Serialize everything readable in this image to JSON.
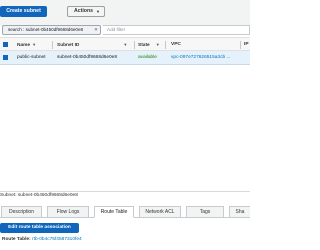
{
  "toolbar": {
    "create_label": "Create subnet",
    "actions_label": "Actions"
  },
  "filter": {
    "search_text": "search : subnet-0b450df9668d6e0e8",
    "add_filter_placeholder": "Add filter"
  },
  "table": {
    "headers": {
      "name": "Name",
      "subnet_id": "Subnet ID",
      "state": "State",
      "vpc": "VPC",
      "ipv4": "IP"
    },
    "rows": [
      {
        "name": "public-subnet",
        "subnet_id": "subnet-0b450df9668d6e0e8",
        "state": "available",
        "vpc": "vpc-097e727626515a3cb ..."
      }
    ]
  },
  "details": {
    "title": "Subnet: subnet-0b450df9668d6e0e8",
    "tabs": [
      "Description",
      "Flow Logs",
      "Route Table",
      "Network ACL",
      "Tags",
      "Sha"
    ],
    "active_tab": "Route Table",
    "edit_button_label": "Edit route table association",
    "route_table_label": "Route Table:",
    "route_table_value": "rtb-0b4c75f4587310fe4"
  },
  "colors": {
    "primary": "#1166bb",
    "selected_row": "#e6f2fb",
    "available": "#1d8102",
    "link": "#0073bb"
  }
}
